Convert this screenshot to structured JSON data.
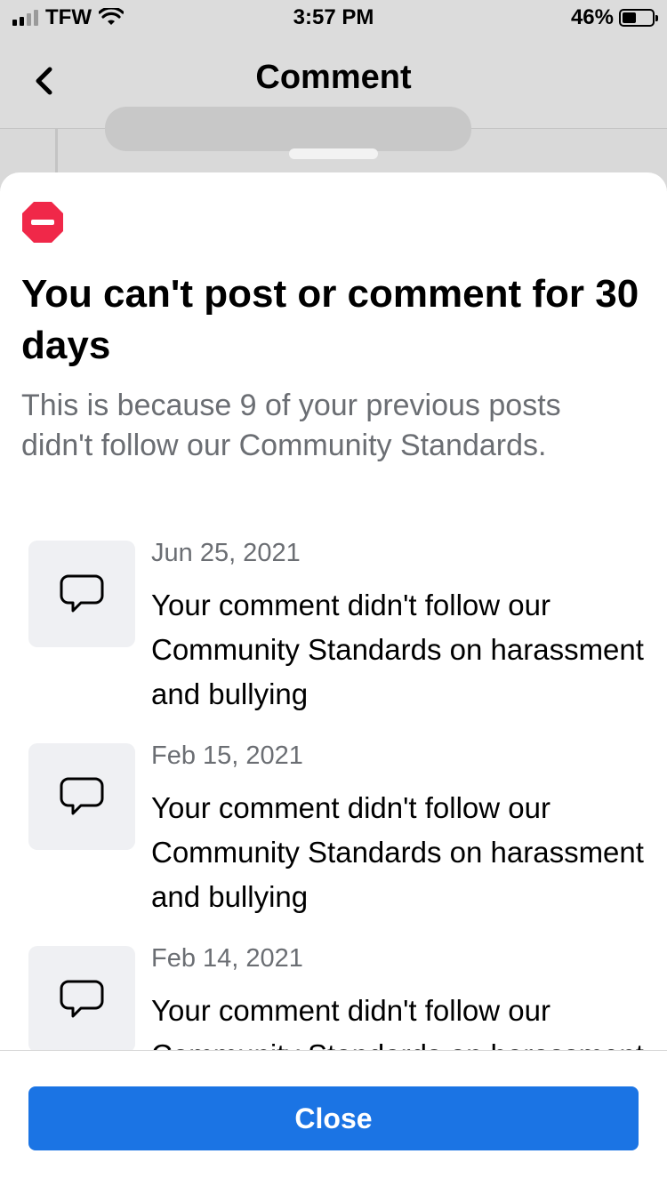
{
  "status_bar": {
    "carrier": "TFW",
    "time": "3:57 PM",
    "battery": "46%",
    "signal_icon": "signal-bars-icon",
    "wifi_icon": "wifi-icon",
    "battery_icon": "battery-icon"
  },
  "nav": {
    "title": "Comment",
    "back_icon": "chevron-left-icon"
  },
  "sheet": {
    "alert_icon": "no-entry-icon",
    "alert_color": "#f02849",
    "headline": "You can't post or comment for 30 days",
    "subtext": "This is because 9 of your previous posts didn't follow our Community Standards.",
    "items": [
      {
        "date": "Jun 25, 2021",
        "text": "Your comment didn't follow our Community Standards on harassment and bullying",
        "icon": "comment-bubble-icon"
      },
      {
        "date": "Feb 15, 2021",
        "text": "Your comment didn't follow our Community Standards on harassment and bullying",
        "icon": "comment-bubble-icon"
      },
      {
        "date": "Feb 14, 2021",
        "text": "Your comment didn't follow our Community Standards on harassment and bullying",
        "icon": "comment-bubble-icon"
      }
    ],
    "close_label": "Close",
    "accent": "#1b74e4"
  }
}
